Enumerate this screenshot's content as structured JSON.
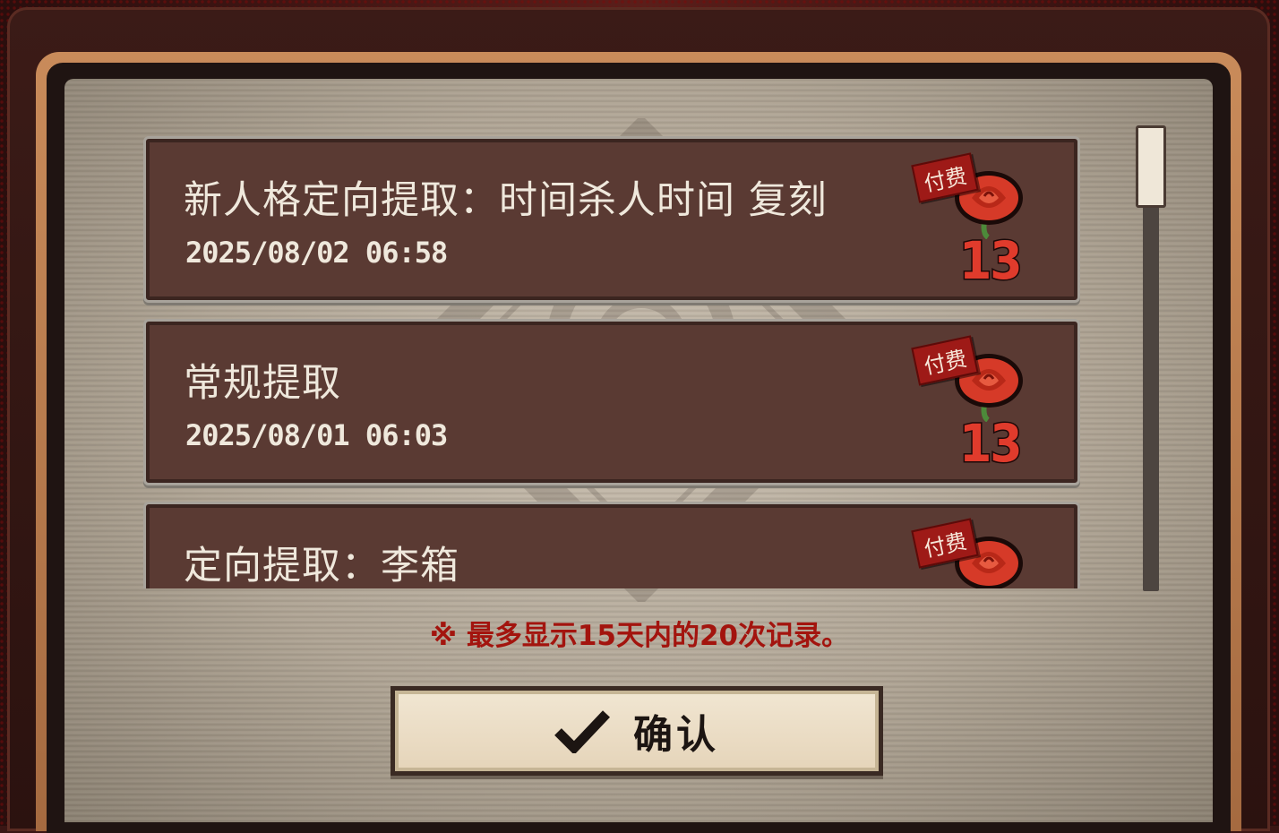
{
  "records": [
    {
      "title": "新人格定向提取：时间杀人时间 复刻",
      "time": "2025/08/02 06:58",
      "tag": "付费",
      "cost": "13",
      "currency_icon": "rose-icon"
    },
    {
      "title": "常规提取",
      "time": "2025/08/01 06:03",
      "tag": "付费",
      "cost": "13",
      "currency_icon": "rose-icon"
    },
    {
      "title": "定向提取：李箱",
      "time": "",
      "tag": "付费",
      "cost": "",
      "currency_icon": "rose-icon"
    }
  ],
  "notice": "※ 最多显示15天内的20次记录。",
  "confirm": {
    "label": "确认",
    "icon": "check-icon"
  },
  "colors": {
    "card_bg": "#5a3a33",
    "paper": "#c9bfb0",
    "notice_red": "#a3140e",
    "paid_tag": "#9e1a17",
    "cost_red": "#e03b2c"
  }
}
